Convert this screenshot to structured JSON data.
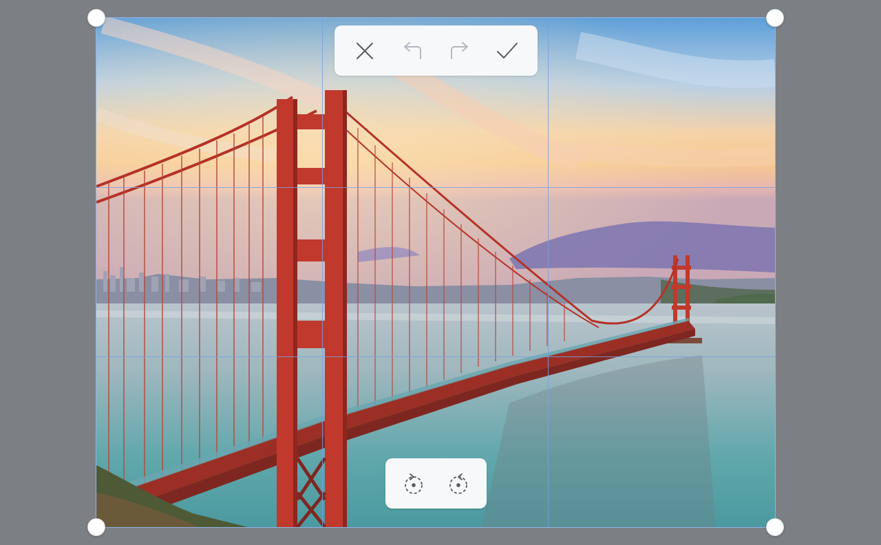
{
  "toolbar": {
    "cancel": {
      "icon": "close-icon",
      "color": "#555a60"
    },
    "undo": {
      "icon": "undo-icon",
      "color": "#b3b8bf"
    },
    "redo": {
      "icon": "redo-icon",
      "color": "#b3b8bf"
    },
    "confirm": {
      "icon": "check-icon",
      "color": "#555a60"
    }
  },
  "rotate": {
    "left": {
      "icon": "rotate-left-icon"
    },
    "right": {
      "icon": "rotate-right-icon"
    }
  },
  "colors": {
    "backdrop": "#7c7f84",
    "gridline": "#8fb4e6",
    "toolbar_bg": "#f7f8fa"
  }
}
